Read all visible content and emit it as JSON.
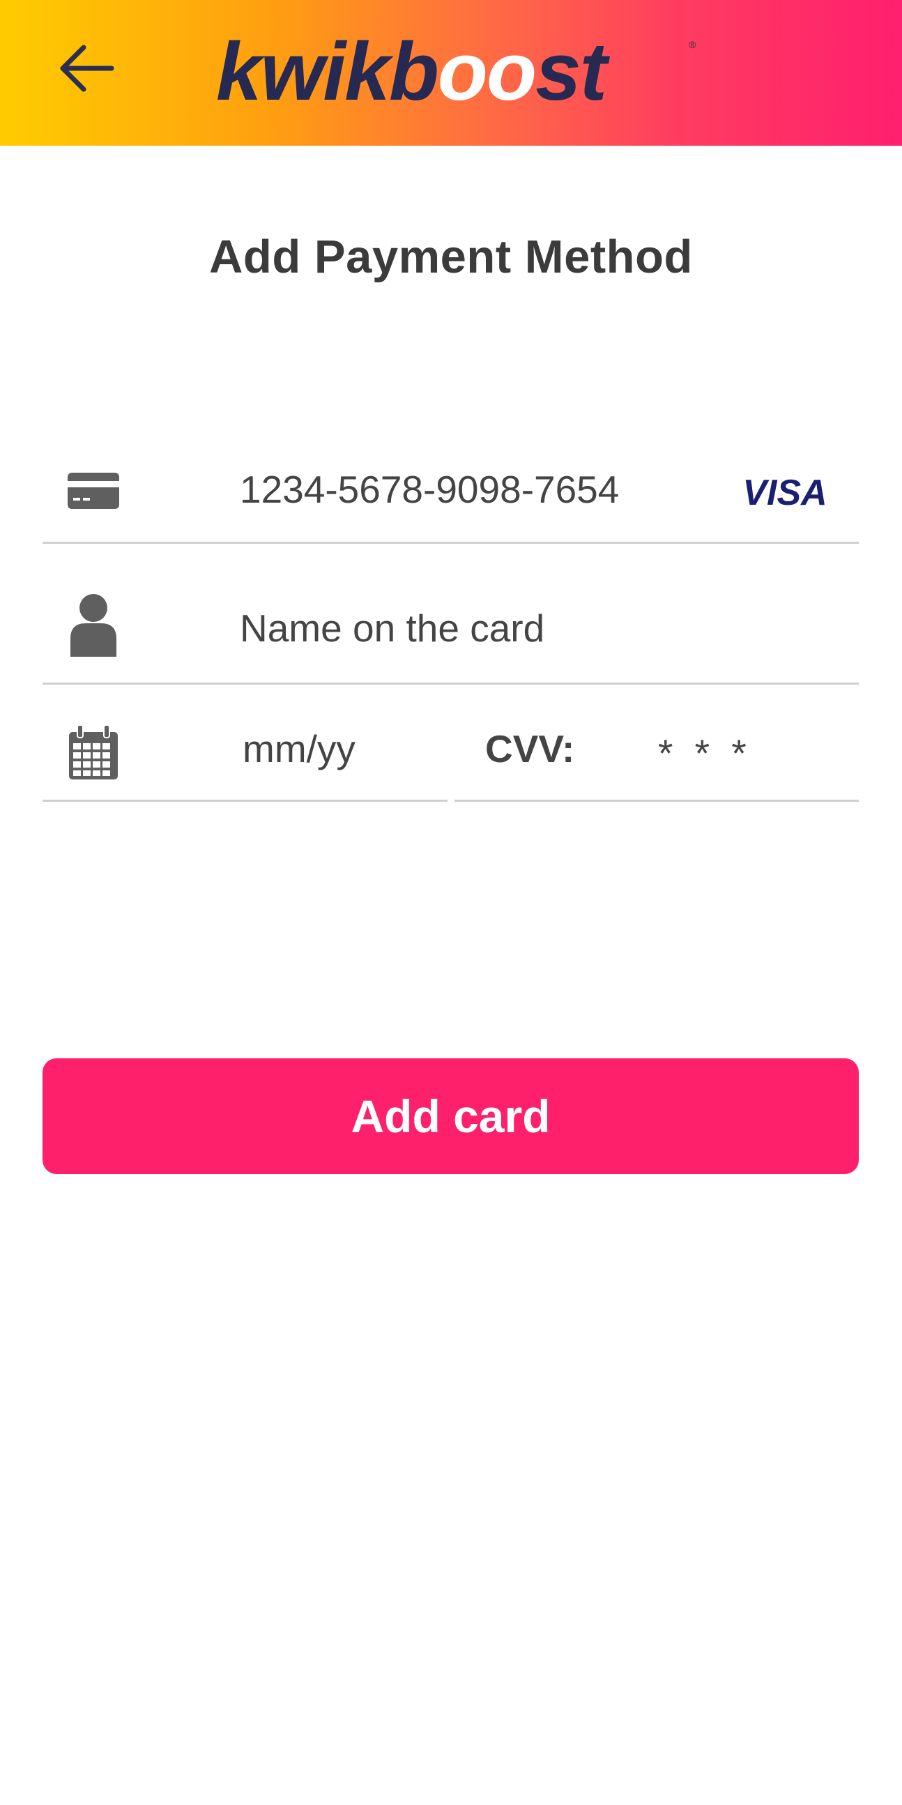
{
  "header": {
    "brand": "kwikboost",
    "back_icon": "arrow-left-icon",
    "gradient": [
      "#ffcc00",
      "#ff1f6e"
    ]
  },
  "page": {
    "title": "Add Payment Method"
  },
  "form": {
    "card_number": {
      "icon": "credit-card-icon",
      "value": "1234-5678-9098-7654",
      "brand": "VISA"
    },
    "name": {
      "icon": "user-icon",
      "placeholder": "Name on the card"
    },
    "expiry": {
      "icon": "calendar-icon",
      "placeholder": "mm/yy"
    },
    "cvv": {
      "label": "CVV:",
      "placeholder": "* * *"
    }
  },
  "actions": {
    "add_card_label": "Add card",
    "accent_color": "#ff206c"
  }
}
